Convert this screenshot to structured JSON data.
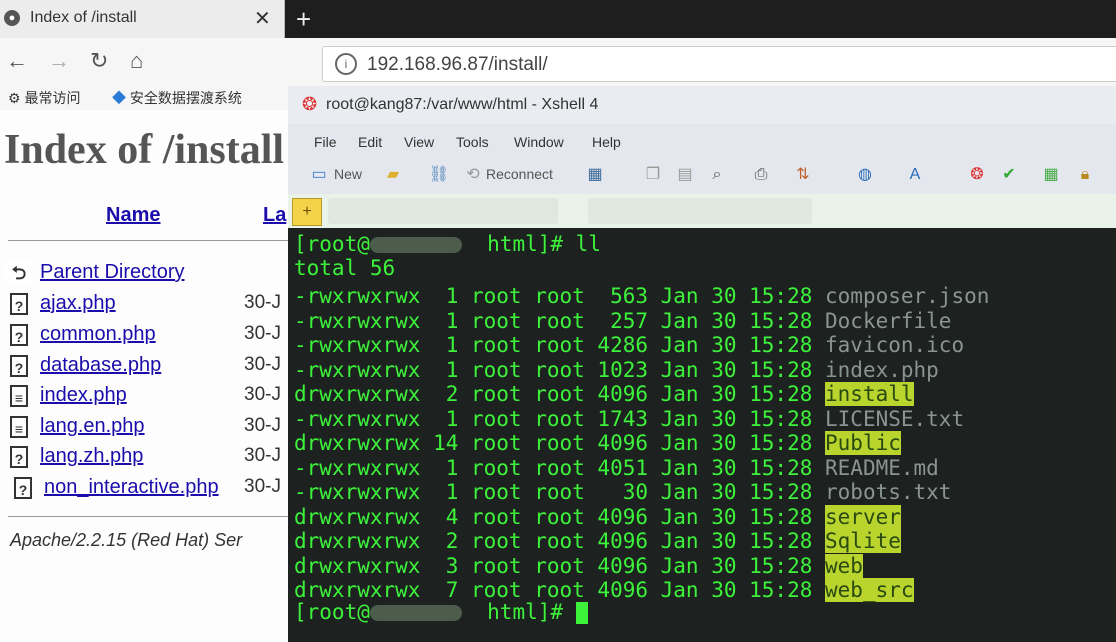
{
  "browser": {
    "tab_title": "Index of /install",
    "tab_close": "✕",
    "new_tab": "+",
    "url": "192.168.96.87/install/",
    "nav": {
      "back": "←",
      "forward": "→",
      "reload": "↻",
      "home": "⌂"
    },
    "bookmarks": [
      {
        "icon": "⚙",
        "label": "最常访问"
      },
      {
        "icon": "◆",
        "label": "安全数据摆渡系统"
      }
    ],
    "page": {
      "title": "Index of /install",
      "columns": {
        "name": "Name",
        "last_modified": "La"
      },
      "parent": "Parent Directory",
      "files": [
        {
          "name": "ajax.php",
          "date": "30-J"
        },
        {
          "name": "common.php",
          "date": "30-J"
        },
        {
          "name": "database.php",
          "date": "30-J"
        },
        {
          "name": "index.php",
          "date": "30-J"
        },
        {
          "name": "lang.en.php",
          "date": "30-J"
        },
        {
          "name": "lang.zh.php",
          "date": "30-J"
        },
        {
          "name": "non_interactive.php",
          "date": "30-J"
        }
      ],
      "server_signature": "Apache/2.2.15 (Red Hat) Ser"
    }
  },
  "xshell": {
    "title": "root@kang87:/var/www/html - Xshell 4",
    "menu": [
      "File",
      "Edit",
      "View",
      "Tools",
      "Window",
      "Help"
    ],
    "toolbar": {
      "new": "New",
      "reconnect": "Reconnect"
    },
    "colors": {
      "text": "#3df23a",
      "background": "#1d2120",
      "highlight": "#b9d42c"
    },
    "prompt_start": "[root@",
    "prompt_end": "html]# ",
    "command": "ll",
    "total": "total 56",
    "listing": [
      {
        "perm": "-rwxrwxrwx",
        "links": "1",
        "user": "root",
        "group": "root",
        "size": "563",
        "month": "Jan",
        "day": "30",
        "time": "15:28",
        "name": "composer.json",
        "dir": false
      },
      {
        "perm": "-rwxrwxrwx",
        "links": "1",
        "user": "root",
        "group": "root",
        "size": "257",
        "month": "Jan",
        "day": "30",
        "time": "15:28",
        "name": "Dockerfile",
        "dir": false
      },
      {
        "perm": "-rwxrwxrwx",
        "links": "1",
        "user": "root",
        "group": "root",
        "size": "4286",
        "month": "Jan",
        "day": "30",
        "time": "15:28",
        "name": "favicon.ico",
        "dir": false
      },
      {
        "perm": "-rwxrwxrwx",
        "links": "1",
        "user": "root",
        "group": "root",
        "size": "1023",
        "month": "Jan",
        "day": "30",
        "time": "15:28",
        "name": "index.php",
        "dir": false
      },
      {
        "perm": "drwxrwxrwx",
        "links": "2",
        "user": "root",
        "group": "root",
        "size": "4096",
        "month": "Jan",
        "day": "30",
        "time": "15:28",
        "name": "install",
        "dir": true
      },
      {
        "perm": "-rwxrwxrwx",
        "links": "1",
        "user": "root",
        "group": "root",
        "size": "1743",
        "month": "Jan",
        "day": "30",
        "time": "15:28",
        "name": "LICENSE.txt",
        "dir": false
      },
      {
        "perm": "drwxrwxrwx",
        "links": "14",
        "user": "root",
        "group": "root",
        "size": "4096",
        "month": "Jan",
        "day": "30",
        "time": "15:28",
        "name": "Public",
        "dir": true
      },
      {
        "perm": "-rwxrwxrwx",
        "links": "1",
        "user": "root",
        "group": "root",
        "size": "4051",
        "month": "Jan",
        "day": "30",
        "time": "15:28",
        "name": "README.md",
        "dir": false
      },
      {
        "perm": "-rwxrwxrwx",
        "links": "1",
        "user": "root",
        "group": "root",
        "size": "30",
        "month": "Jan",
        "day": "30",
        "time": "15:28",
        "name": "robots.txt",
        "dir": false
      },
      {
        "perm": "drwxrwxrwx",
        "links": "4",
        "user": "root",
        "group": "root",
        "size": "4096",
        "month": "Jan",
        "day": "30",
        "time": "15:28",
        "name": "server",
        "dir": true
      },
      {
        "perm": "drwxrwxrwx",
        "links": "2",
        "user": "root",
        "group": "root",
        "size": "4096",
        "month": "Jan",
        "day": "30",
        "time": "15:28",
        "name": "Sqlite",
        "dir": true
      },
      {
        "perm": "drwxrwxrwx",
        "links": "3",
        "user": "root",
        "group": "root",
        "size": "4096",
        "month": "Jan",
        "day": "30",
        "time": "15:28",
        "name": "web",
        "dir": true
      },
      {
        "perm": "drwxrwxrwx",
        "links": "7",
        "user": "root",
        "group": "root",
        "size": "4096",
        "month": "Jan",
        "day": "30",
        "time": "15:28",
        "name": "web_src",
        "dir": true
      }
    ]
  }
}
